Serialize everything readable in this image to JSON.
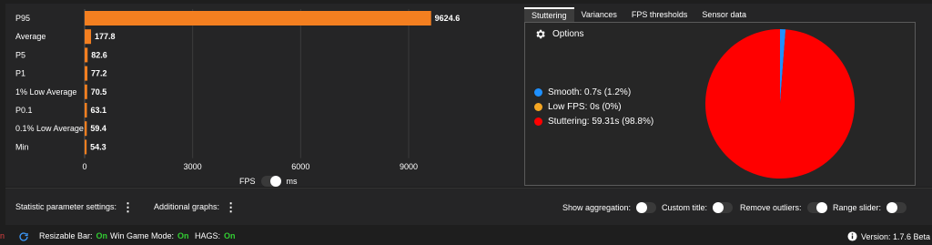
{
  "chart_data": {
    "type": "bar",
    "orientation": "horizontal",
    "categories": [
      "P95",
      "Average",
      "P5",
      "P1",
      "1% Low Average",
      "P0.1",
      "0.1% Low Average",
      "Min"
    ],
    "values": [
      9624.6,
      177.8,
      82.6,
      77.2,
      70.5,
      63.1,
      59.4,
      54.3
    ],
    "value_labels": [
      "9624.6",
      "177.8",
      "82.6",
      "77.2",
      "70.5",
      "63.1",
      "59.4",
      "54.3"
    ],
    "xlim": [
      0,
      11200
    ],
    "xticks": [
      "0",
      "3000",
      "6000",
      "9000"
    ],
    "xtick_values": [
      0,
      3000,
      6000,
      9000
    ],
    "grid": true,
    "bar_color": "#f47f20"
  },
  "unit_toggle": {
    "left": "FPS",
    "right": "ms",
    "selected": "FPS"
  },
  "tabs": [
    "Stuttering",
    "Variances",
    "FPS thresholds",
    "Sensor data"
  ],
  "active_tab": "Stuttering",
  "stuttering": {
    "options_label": "Options",
    "legend": [
      {
        "label": "Smooth:  0.7s (1.2%)",
        "color": "#1e90ff"
      },
      {
        "label": "Low FPS:  0s (0%)",
        "color": "#f5a623"
      },
      {
        "label": "Stuttering:  59.31s (98.8%)",
        "color": "#ff0000"
      }
    ],
    "pie_values": [
      1.2,
      0.0,
      98.8
    ]
  },
  "settings": {
    "statistic_params": "Statistic parameter settings:",
    "additional_graphs": "Additional graphs:",
    "show_aggregation": "Show aggregation:",
    "custom_title": "Custom title:",
    "remove_outliers": "Remove outliers:",
    "range_slider": "Range slider:"
  },
  "status": {
    "left_mark": "n",
    "resizable_bar": "Resizable Bar:",
    "resizable_bar_value": "On",
    "game_mode": "Win Game Mode:",
    "game_mode_value": "On",
    "hags": "HAGS:",
    "hags_value": "On",
    "version": "Version:  1.7.6 Beta"
  }
}
